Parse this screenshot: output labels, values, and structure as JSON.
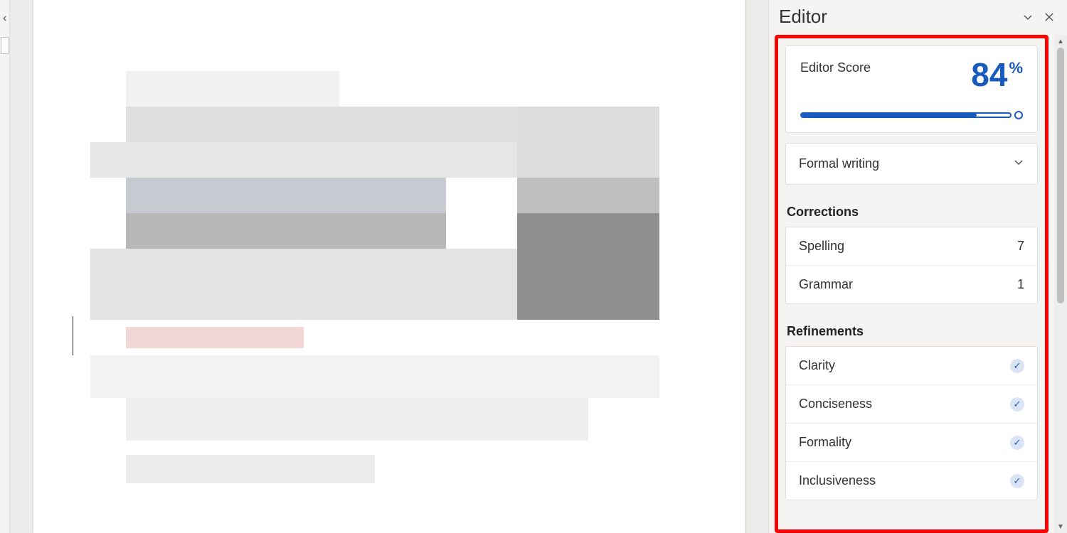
{
  "panel": {
    "title": "Editor"
  },
  "score": {
    "label": "Editor Score",
    "value": "84",
    "percent_symbol": "%",
    "percent": 84
  },
  "writing_style": {
    "selected": "Formal writing"
  },
  "corrections": {
    "title": "Corrections",
    "items": [
      {
        "label": "Spelling",
        "count": "7"
      },
      {
        "label": "Grammar",
        "count": "1"
      }
    ]
  },
  "refinements": {
    "title": "Refinements",
    "items": [
      {
        "label": "Clarity",
        "done": true
      },
      {
        "label": "Conciseness",
        "done": true
      },
      {
        "label": "Formality",
        "done": true
      },
      {
        "label": "Inclusiveness",
        "done": true
      }
    ]
  }
}
